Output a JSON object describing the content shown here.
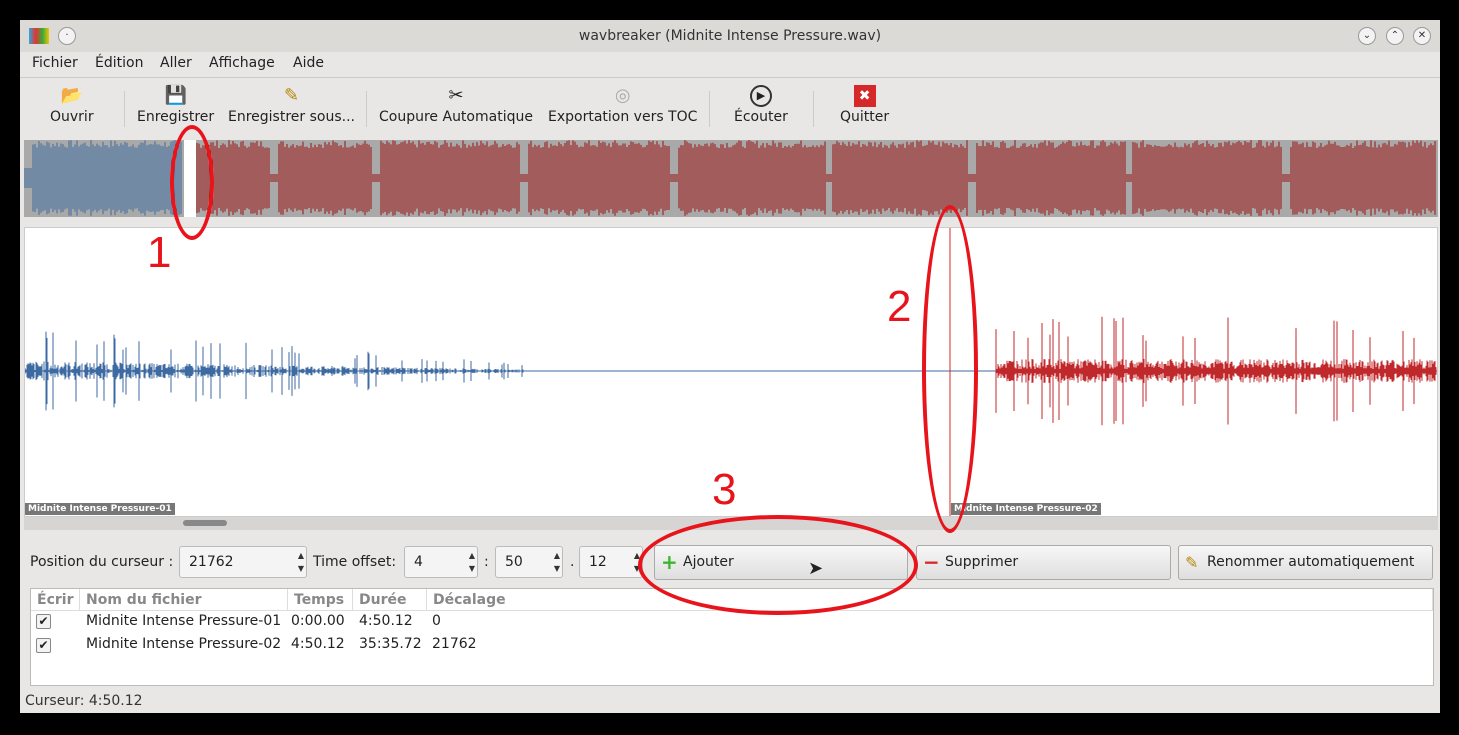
{
  "window": {
    "title": "wavbreaker (Midnite Intense Pressure.wav)",
    "btn_min": "⌄",
    "btn_max": "⌃",
    "btn_close": "✕",
    "btn_menu": "·"
  },
  "menu": [
    "Fichier",
    "Édition",
    "Aller",
    "Affichage",
    "Aide"
  ],
  "toolbar": [
    {
      "label": "Ouvrir",
      "icon": "open-icon",
      "glyph": "📂"
    },
    {
      "label": "Enregistrer",
      "icon": "save-icon",
      "glyph": "💾"
    },
    {
      "label": "Enregistrer sous...",
      "icon": "save-as-icon",
      "glyph": "✎"
    },
    {
      "label": "Coupure Automatique",
      "icon": "scissors-icon",
      "glyph": "✂"
    },
    {
      "label": "Exportation vers TOC",
      "icon": "cd-icon",
      "glyph": "◎"
    },
    {
      "label": "Écouter",
      "icon": "play-icon",
      "glyph": "▶"
    },
    {
      "label": "Quitter",
      "icon": "quit-icon",
      "glyph": "✖"
    }
  ],
  "waveform": {
    "track_labels": [
      "Midnite Intense Pressure-01",
      "Midnite Intense Pressure-02"
    ],
    "colors": {
      "first": "#3d6aa0",
      "second": "#c0292b",
      "overview_second": "#9b1010"
    }
  },
  "controls": {
    "cursor_label": "Position du curseur :",
    "cursor_value": "21762",
    "offset_label": "Time offset:",
    "min": "4",
    "sec": "50",
    "frac": "12",
    "sep1": ":",
    "sep2": ".",
    "add": "Ajouter",
    "remove": "Supprimer",
    "rename": "Renommer automatiquement"
  },
  "table": {
    "headers": [
      "Écrir",
      "Nom du fichier",
      "Temps",
      "Durée",
      "Décalage"
    ],
    "rows": [
      {
        "checked": "✔",
        "name": "Midnite Intense Pressure-01",
        "time": "0:00.00",
        "duration": "4:50.12",
        "offset": "0"
      },
      {
        "checked": "✔",
        "name": "Midnite Intense Pressure-02",
        "time": "4:50.12",
        "duration": "35:35.72",
        "offset": "21762"
      }
    ]
  },
  "status": "Curseur: 4:50.12",
  "annotations": [
    "1",
    "2",
    "3"
  ]
}
